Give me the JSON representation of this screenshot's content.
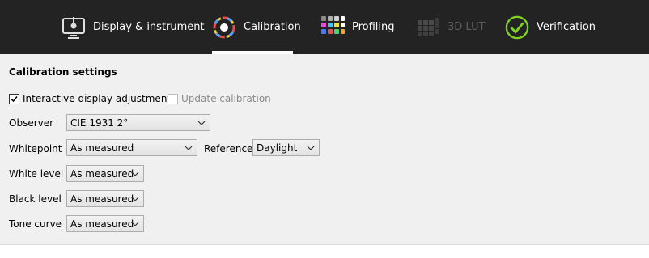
{
  "tabs": [
    {
      "label": "Display & instrument",
      "icon": "display-instrument-icon",
      "state": "normal"
    },
    {
      "label": "Calibration",
      "icon": "calibration-icon",
      "state": "selected"
    },
    {
      "label": "Profiling",
      "icon": "profiling-icon",
      "state": "normal"
    },
    {
      "label": "3D LUT",
      "icon": "3d-lut-icon",
      "state": "disabled"
    },
    {
      "label": "Verification",
      "icon": "verification-icon",
      "state": "normal"
    }
  ],
  "section_title": "Calibration settings",
  "options": {
    "interactive": {
      "label": "Interactive display adjustment",
      "checked": true
    },
    "update": {
      "label": "Update calibration",
      "checked": false,
      "disabled": true
    }
  },
  "fields": {
    "observer": {
      "label": "Observer",
      "value": "CIE 1931 2°"
    },
    "whitepoint": {
      "label": "Whitepoint",
      "value": "As measured"
    },
    "reference": {
      "label": "Reference",
      "value": "Daylight"
    },
    "white_level": {
      "label": "White level",
      "value": "As measured"
    },
    "black_level": {
      "label": "Black level",
      "value": "As measured"
    },
    "tone_curve": {
      "label": "Tone curve",
      "value": "As measured"
    }
  },
  "colors": {
    "tabbar_bg": "#232323",
    "verification_accent": "#7ed321",
    "panel_bg": "#f0f0f0"
  }
}
